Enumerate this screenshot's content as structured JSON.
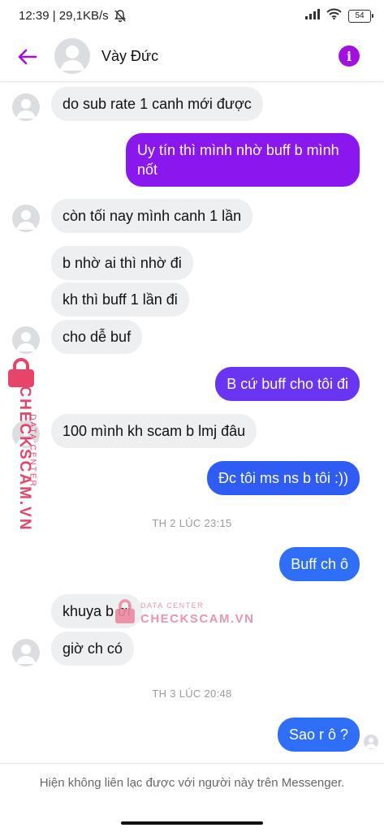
{
  "status_bar": {
    "time_speed": "12:39 | 29,1KB/s",
    "battery": "54"
  },
  "header": {
    "contact_name": "Vày Đức"
  },
  "messages": [
    {
      "text": "do sub rate 1 canh mới được"
    },
    {
      "text": "Uy tín thì mình nhờ buff b mình nốt"
    },
    {
      "text": "còn tối nay mình canh 1 lần"
    },
    {
      "text": "b nhờ ai thì nhờ đi"
    },
    {
      "text": "kh thì buff 1 lần đi"
    },
    {
      "text": "cho dễ buf"
    },
    {
      "text": "B cứ buff cho tôi đi"
    },
    {
      "text": "100 mình kh scam b lmj đâu"
    },
    {
      "text": "Đc tôi ms ns b tôi :))"
    },
    {
      "text": "Buff ch ô"
    },
    {
      "text": "khuya b ơi"
    },
    {
      "text": "giờ ch có"
    },
    {
      "text": "Sao r ô ?"
    }
  ],
  "timestamps": [
    "TH 2 LÚC 23:15",
    "TH 3 LÚC 20:48"
  ],
  "footer": {
    "notice": "Hiện không liên lạc được với người này trên Messenger."
  },
  "watermark": {
    "line1": "DATA CENTER",
    "line2": "CHECKSCAM.VN"
  },
  "colors": {
    "accent": "#a20fe0",
    "outgoing_purple": "#8a17ee",
    "outgoing_indigo": "#6a35f2",
    "outgoing_blue": "#2f5cf3",
    "outgoing_blue_light": "#2f6ef6",
    "incoming": "#eeeff1",
    "watermark": "#e63a62"
  },
  "icons": [
    "back-arrow-icon",
    "info-icon",
    "wifi-icon",
    "signal-icon",
    "mute-icon",
    "battery-icon",
    "avatar-icon",
    "lock-icon"
  ]
}
